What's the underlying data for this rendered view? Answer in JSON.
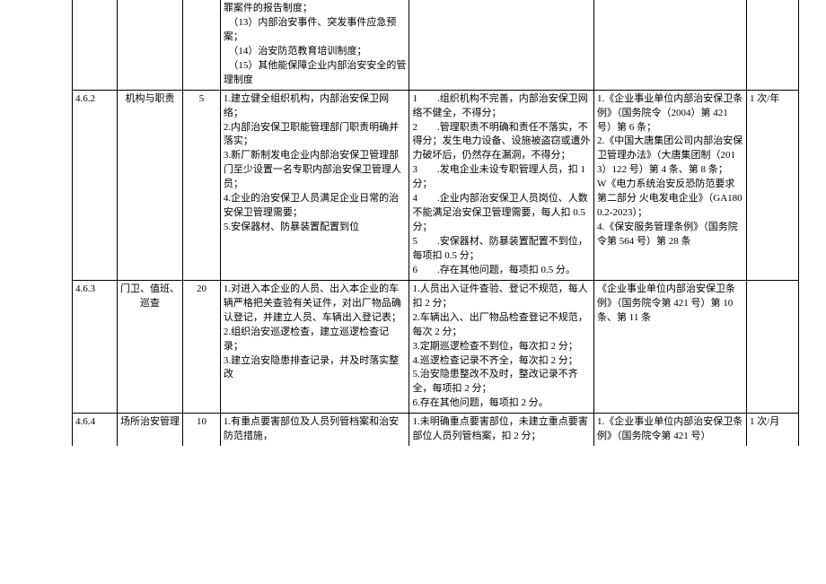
{
  "rows": [
    {
      "c1": "",
      "c2": "",
      "c3": "",
      "c4": "罪案件的报告制度；\n　（13）内部治安事件、突发事件应急预案；\n　（14）治安防范教育培训制度；\n　（15）其他能保障企业内部治安安全的管理制度",
      "c5": "",
      "c6": "",
      "c7": ""
    },
    {
      "c1": "4.6.2",
      "c2": "机构与职责",
      "c3": "5",
      "c4": "1.建立健全组织机构，内部治安保卫网络；\n2.内部治安保卫职能管理部门职责明确并落实；\n3.新厂新制发电企业内部治安保卫管理部门至少设置一名专职内部治安保卫管理人员；\n4.企业的治安保卫人员满足企业日常的治安保卫管理需要；\n5.安保器材、防暴装置配置到位",
      "c5": "1　　.组织机构不完善，内部治安保卫网络不健全，不得分；\n2　　.管理职责不明确和责任不落实，不得分；发生电力设备、设施被盗窃或遭外力破坏后，仍然存在漏洞，不得分；\n3　　.发电企业未设专职管理人员，扣 1 分；\n4　　.企业内部治安保卫人员岗位、人数不能满足治安保卫管理需要，每人扣 0.5 分；\n5　　.安保器材、防暴装置配置不到位，每项扣 0.5 分；\n6　　.存在其他问题，每项扣 0.5 分。",
      "c6": "1.《企业事业单位内部治安保卫条例》（国务院令（2004）第 421 号）第 6 条；\n2.《中国大唐集团公司内部治安保卫管理办法》（大唐集团制（2013）122 号）第 4 条、第 8 条；\nW《电力系统治安反恐防范要求第二部分 火电发电企业》（GA1800.2-2023）；\n4.《保安服务管理条例》（国务院令第 564 号）第 28 条",
      "c7": "1 次/年"
    },
    {
      "c1": "4.6.3",
      "c2": "门卫、值班、巡查",
      "c3": "20",
      "c4": "1.对进入本企业的人员、出入本企业的车辆严格把关查验有关证件，对出厂物品确认登记，并建立人员、车辆出入登记表；\n2.组织治安巡逻检查，建立巡逻检查记录；\n3.建立治安隐患排查记录，并及时落实整改",
      "c5": "1.人员出入证件查验、登记不规范，每人扣 2 分；\n2.车辆出入、出厂物品检查登记不规范，每次 2 分；\n3.定期巡逻检查不到位，每次扣 2 分；\n4.巡逻检查记录不齐全，每次扣 2 分；\n5.治安隐患整改不及时，整改记录不齐全，每项扣 2 分；\n6.存在其他问题，每项扣 2 分。",
      "c6": "《企业事业单位内部治安保卫条例》（国务院令第 421 号）第 10 条、第 11 条",
      "c7": ""
    },
    {
      "c1": "4.6.4",
      "c2": "场所治安管理",
      "c3": "10",
      "c4": "1.有重点要害部位及人员列管档案和治安防范措施，",
      "c5": "1.未明确重点要害部位，未建立重点要害部位人员列管档案，扣 2 分；",
      "c6": "1.《企业事业单位内部治安保卫条例》（国务院令第 421 号）",
      "c7": "1 次/月"
    }
  ]
}
